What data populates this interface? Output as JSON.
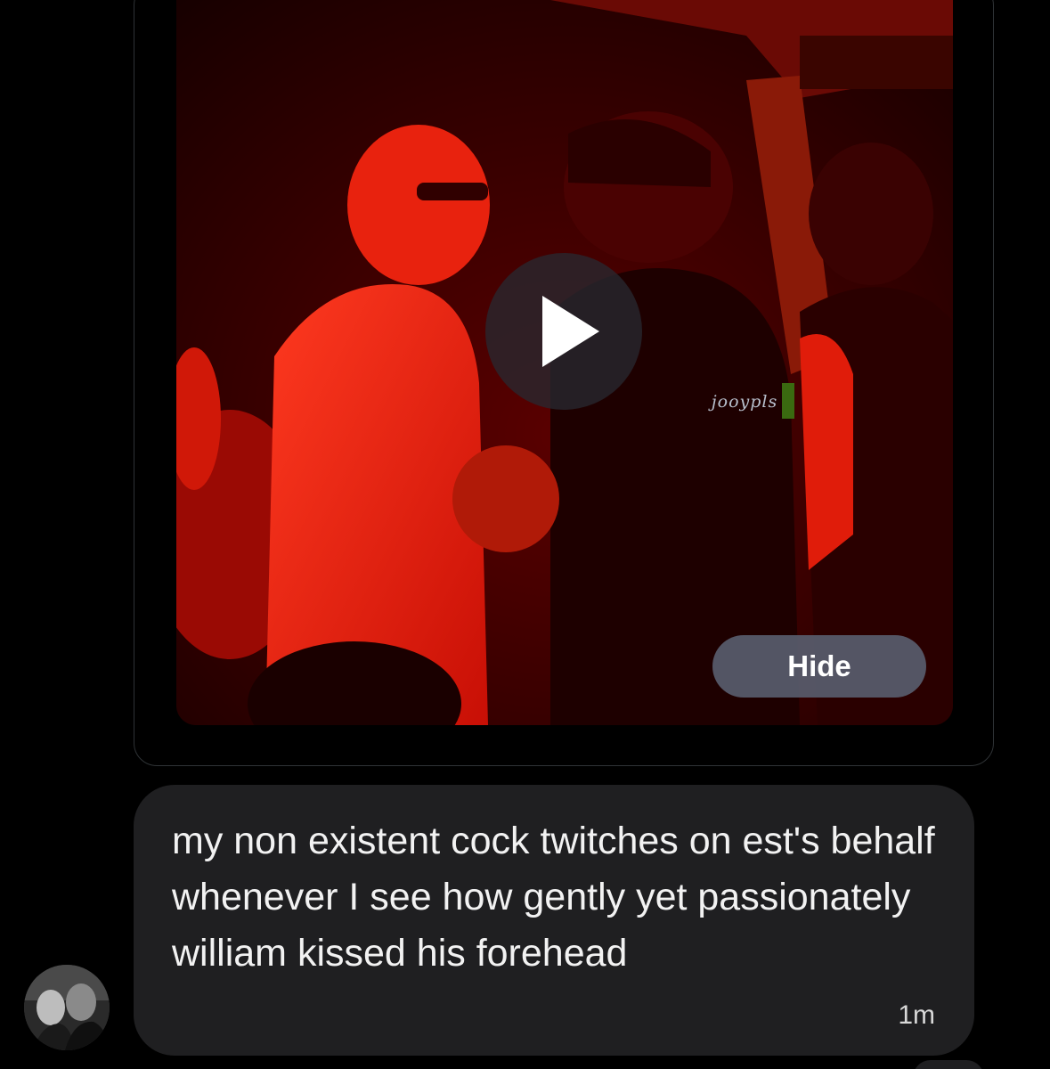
{
  "video": {
    "watermark_text": "jooypls",
    "hide_label": "Hide",
    "play_icon": "play-icon",
    "scene_palette": [
      "#ff1a10",
      "#8b0000",
      "#2a0000",
      "#c01000"
    ]
  },
  "message": {
    "text": "my non existent cock twitches on est's behalf whenever I see how gently yet passionately william kissed his forehead",
    "timestamp": "1m",
    "bubble_color": "#1f1f21",
    "text_color": "#f2f2f2"
  },
  "sender": {
    "avatar_icon": "avatar-image"
  }
}
